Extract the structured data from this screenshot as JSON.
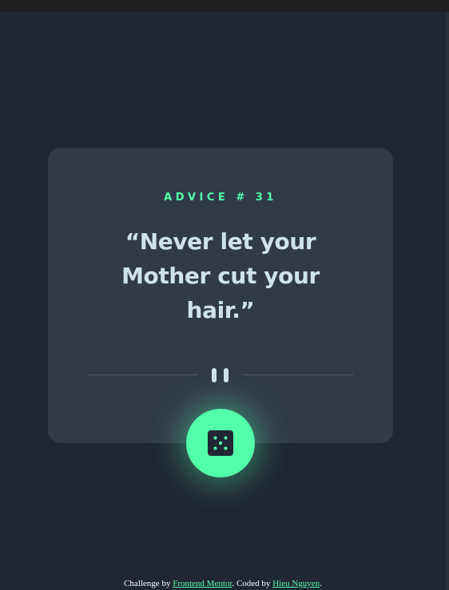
{
  "colors": {
    "background": "#202632",
    "card": "#323a49",
    "accent": "#52ffa8",
    "text": "#cee3e9",
    "divider": "#4f5d74"
  },
  "advice": {
    "id_label": "ADVICE # 31",
    "quote": "“Never let your Mother cut your hair.”"
  },
  "divider": {
    "icon": "pause-icon"
  },
  "button": {
    "icon": "dice-icon"
  },
  "footer": {
    "prefix": "Challenge by ",
    "challenge_link": "Frontend Mentor",
    "middle": ". Coded by ",
    "author_link": "Hieu Nguyen",
    "suffix": "."
  }
}
